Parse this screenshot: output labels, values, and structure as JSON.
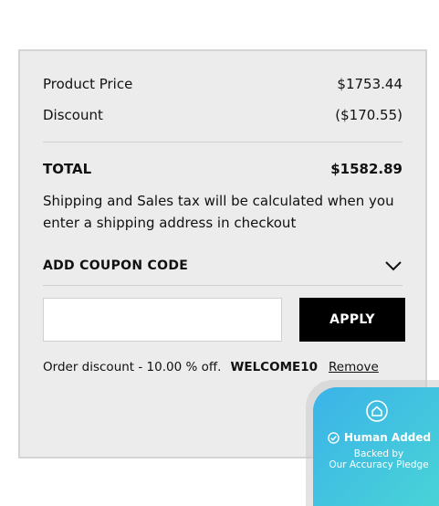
{
  "summary": {
    "product_price_label": "Product Price",
    "product_price_value": "$1753.44",
    "discount_label": "Discount",
    "discount_value": "($170.55)",
    "total_label": "TOTAL",
    "total_value": "$1582.89",
    "shipping_note": "Shipping and Sales tax will be calculated when you enter a shipping address in checkout"
  },
  "coupon": {
    "header_label": "ADD COUPON CODE",
    "input_value": "",
    "apply_label": "APPLY",
    "applied_text": "Order discount - 10.00 % off.",
    "applied_code": "WELCOME10",
    "remove_label": "Remove"
  },
  "badge": {
    "title": "Human Added",
    "line1": "Backed by",
    "line2": "Our Accuracy Pledge",
    "gradient_start": "#3bb3e8",
    "gradient_end": "#4ad6d6"
  },
  "icons": {
    "chevron": "chevron-down-icon",
    "home": "home-icon",
    "check": "check-circle-icon"
  }
}
